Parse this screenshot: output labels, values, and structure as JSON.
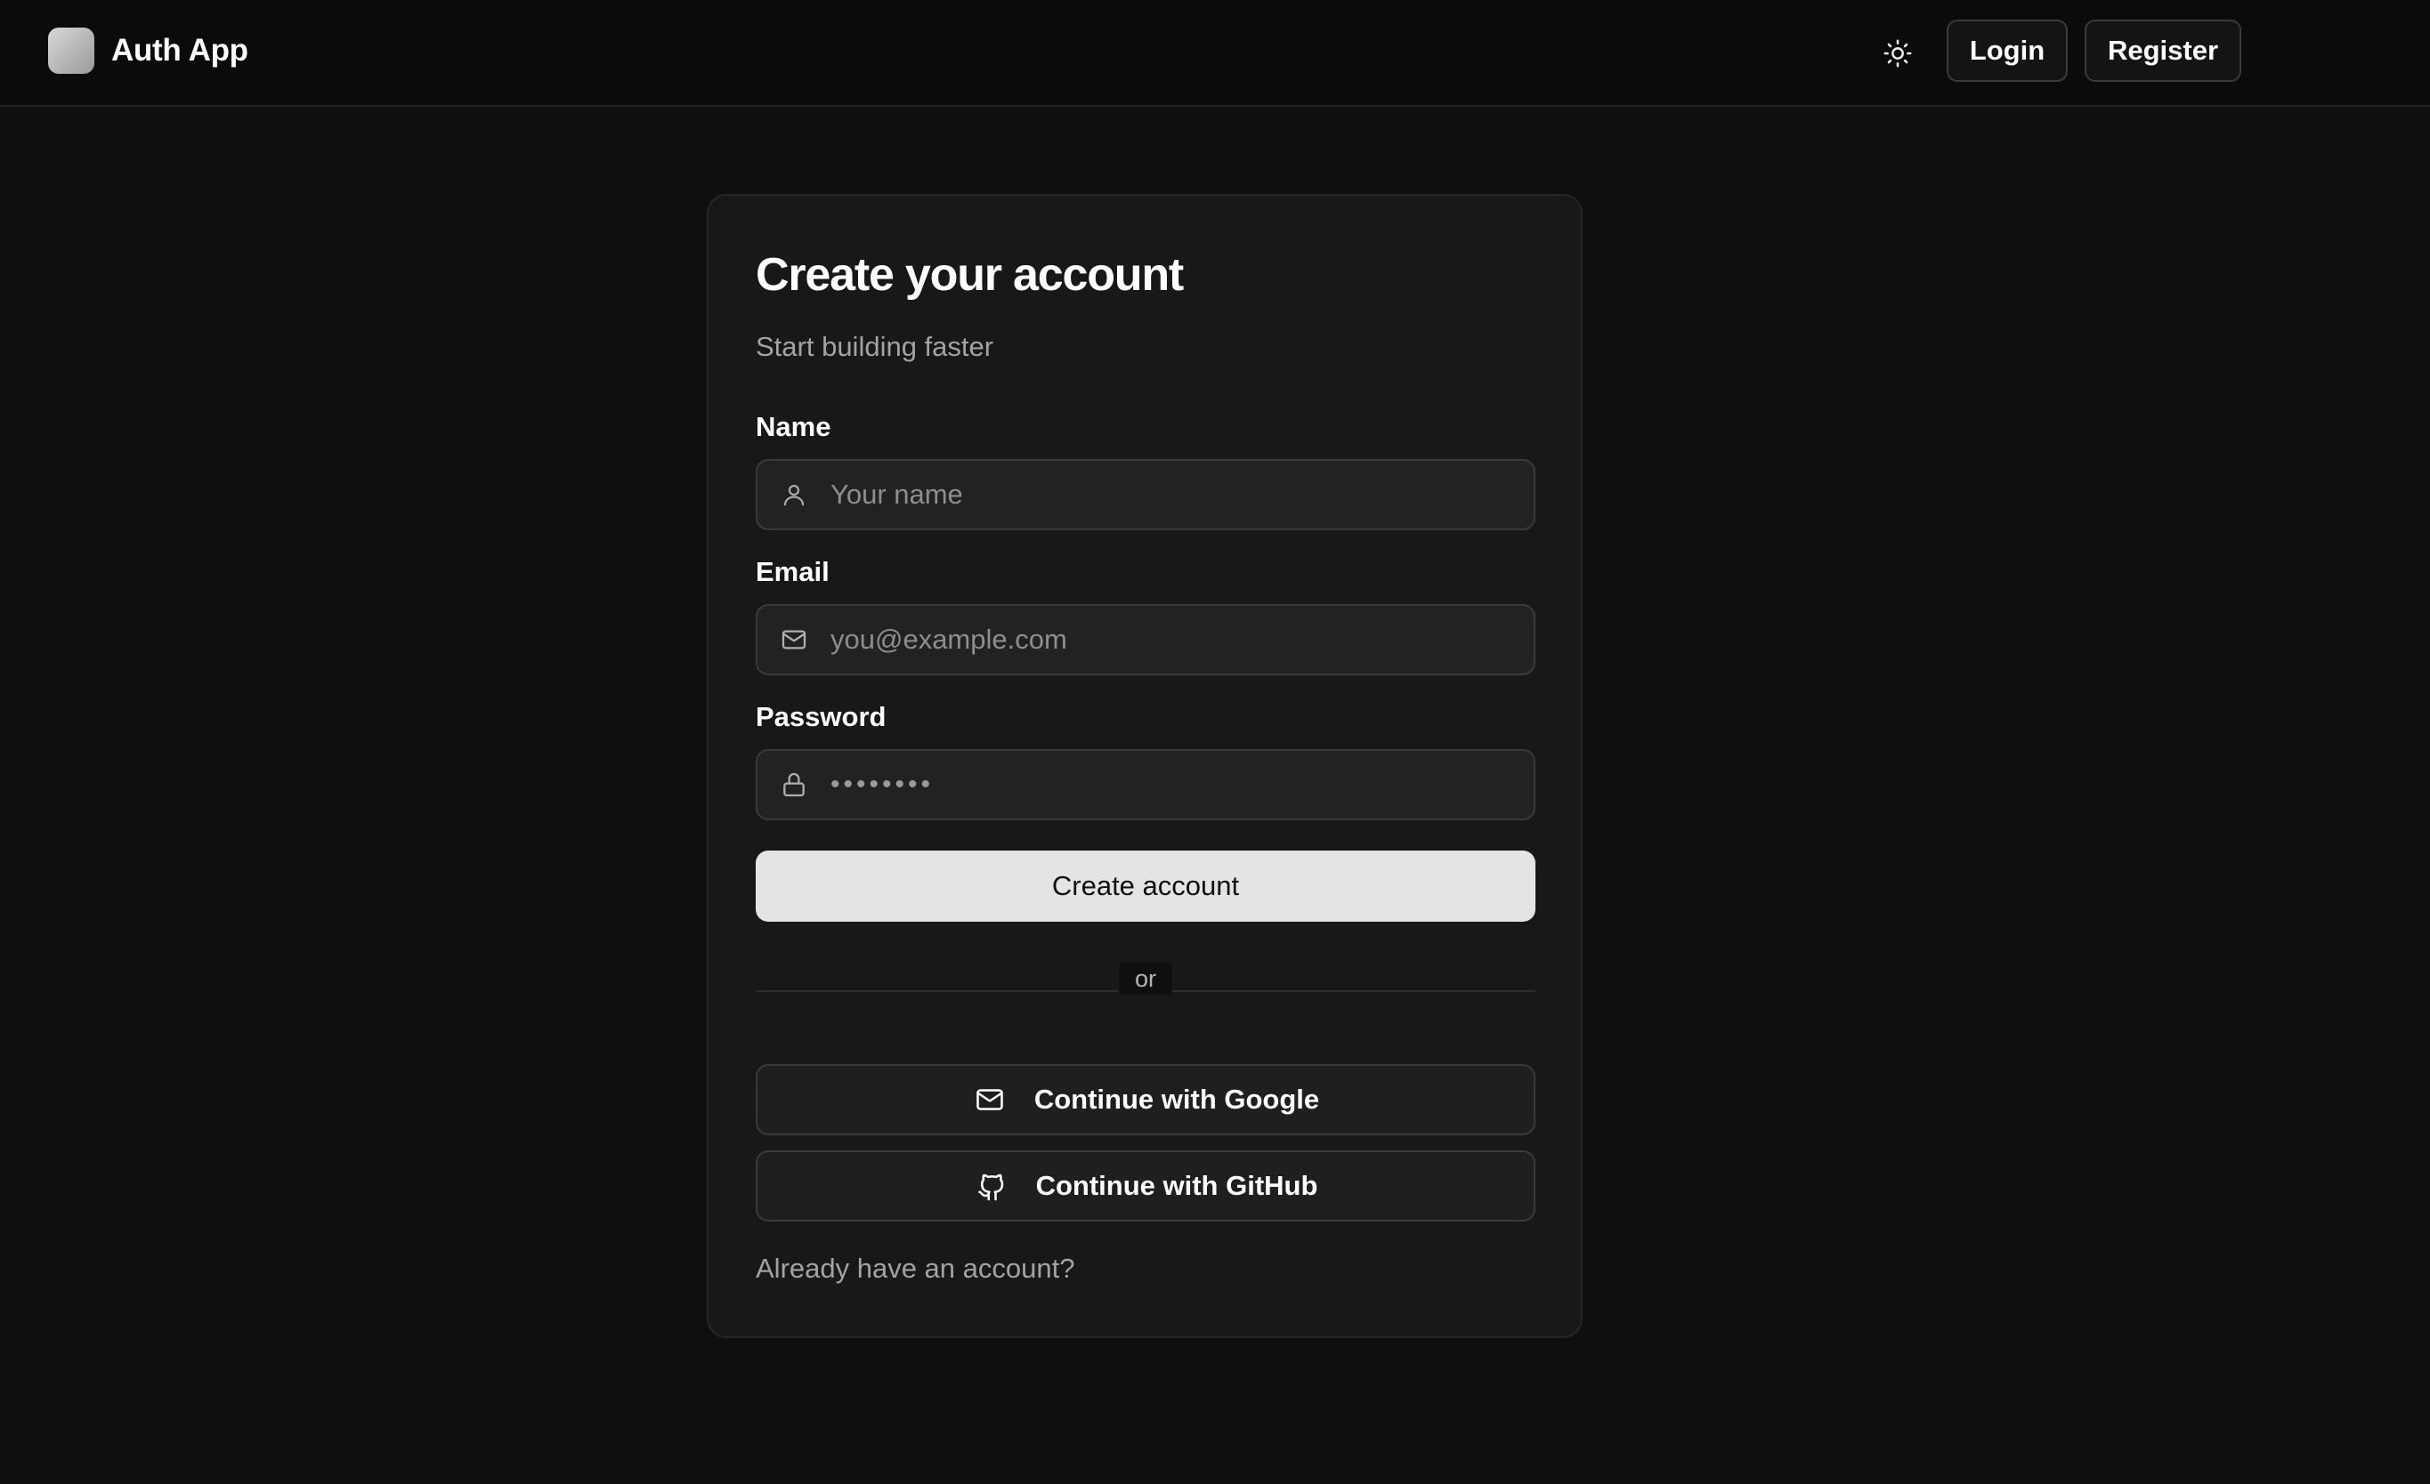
{
  "header": {
    "app_title": "Auth App",
    "logo_icon": "app-logo",
    "theme_icon": "sun-icon",
    "login_label": "Login",
    "register_label": "Register"
  },
  "form": {
    "title": "Create your account",
    "subtitle": "Start building faster",
    "name": {
      "label": "Name",
      "placeholder": "Your name",
      "icon": "user-icon"
    },
    "email": {
      "label": "Email",
      "placeholder": "you@example.com",
      "icon": "mail-icon"
    },
    "password": {
      "label": "Password",
      "value_masked": "••••••••",
      "icon": "lock-icon"
    },
    "submit_label": "Create account",
    "divider_text": "or",
    "google_label": "Continue with Google",
    "google_icon": "mail-icon",
    "github_label": "Continue with GitHub",
    "github_icon": "github-icon",
    "signin_prompt": "Already have an account?"
  },
  "colors": {
    "background": "#0f0f0f",
    "card": "#181818",
    "input": "#222222",
    "primary_button": "#e4e4e4",
    "text_primary": "#ffffff",
    "text_muted": "#a3a3a3"
  }
}
